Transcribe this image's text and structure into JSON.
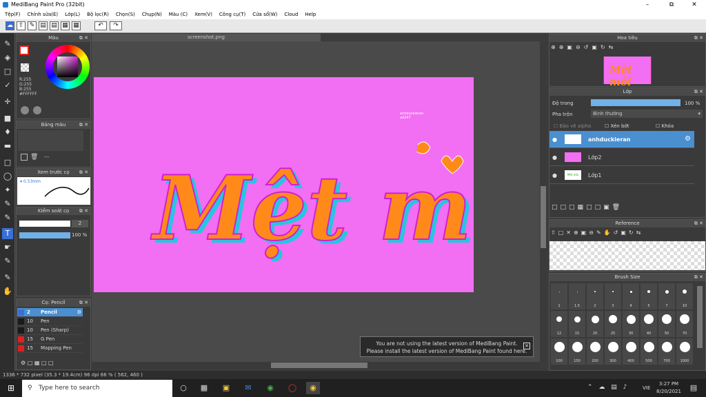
{
  "window": {
    "title": "MediBang Paint Pro (32bit)"
  },
  "menu": [
    "Tệp(F)",
    "Chỉnh sửa(E)",
    "Lớp(L)",
    "Bộ lọc(R)",
    "Chọn(S)",
    "Chụp(N)",
    "Màu (C)",
    "Xem(V)",
    "Công cụ(T)",
    "Cửa sổ(W)",
    "Cloud",
    "Help"
  ],
  "panels": {
    "color": {
      "title": "Màu",
      "r": "R:255",
      "g": "G:255",
      "b": "B:255",
      "hex": "#FFFFFF"
    },
    "palette": {
      "title": "Bảng màu",
      "value": "---"
    },
    "brush_preview": {
      "title": "Xem trước cọ",
      "size": "0.53mm"
    },
    "brush_control": {
      "title": "Kiểm soát cọ",
      "size": "2",
      "opacity": "100 %"
    },
    "brushes": {
      "title": "Cọ: Pencil",
      "items": [
        {
          "size": "2",
          "name": "Pencil",
          "color": "#3a6fd8",
          "active": true
        },
        {
          "size": "10",
          "name": "Pen",
          "color": "#1a1a1a"
        },
        {
          "size": "10",
          "name": "Pen (Sharp)",
          "color": "#1a1a1a"
        },
        {
          "size": "15",
          "name": "G Pen",
          "color": "#e02020"
        },
        {
          "size": "15",
          "name": "Mapping Pen",
          "color": "#e02020"
        }
      ]
    },
    "navigator": {
      "title": "Hoa tiêu"
    },
    "layer": {
      "title": "Lớp",
      "opacity_label": "Độ trong",
      "opacity": "100 %",
      "blend_label": "Pha trộn",
      "blend": "Bình thường",
      "protect_alpha": "Bảo vệ alpha",
      "clipping": "Xén bớt",
      "lock": "Khóa",
      "layers": [
        {
          "name": "anhduckieran",
          "active": true
        },
        {
          "name": "Lớp2"
        },
        {
          "name": "Lớp1",
          "thumb_text": "Mệt mỏi"
        }
      ]
    },
    "reference": {
      "title": "Reference"
    },
    "brush_size": {
      "title": "Brush Size",
      "sizes": [
        "1",
        "1.5",
        "2",
        "3",
        "4",
        "5",
        "7",
        "10",
        "12",
        "15",
        "20",
        "25",
        "30",
        "40",
        "50",
        "70",
        "100",
        "150",
        "200",
        "300",
        "400",
        "500",
        "700",
        "1000"
      ]
    }
  },
  "document": {
    "tab": "screenshot.png",
    "art_text": "Mệt mỏi",
    "small_text": "anhduckieran",
    "small_text2": "ad247",
    "bg": "#f26ef2"
  },
  "status": "1336 * 732 pixel  (35.3 * 19.4cm)  96 dpi  66 %  ( 562, 460 )",
  "notification": {
    "line1": "You are not using the latest version of MediBang Paint.",
    "line2": "Please install the latest version of MediBang Paint found here."
  },
  "taskbar": {
    "search": "Type here to search",
    "time": "3:27 PM",
    "date": "8/20/2021",
    "lang": "VIE"
  }
}
